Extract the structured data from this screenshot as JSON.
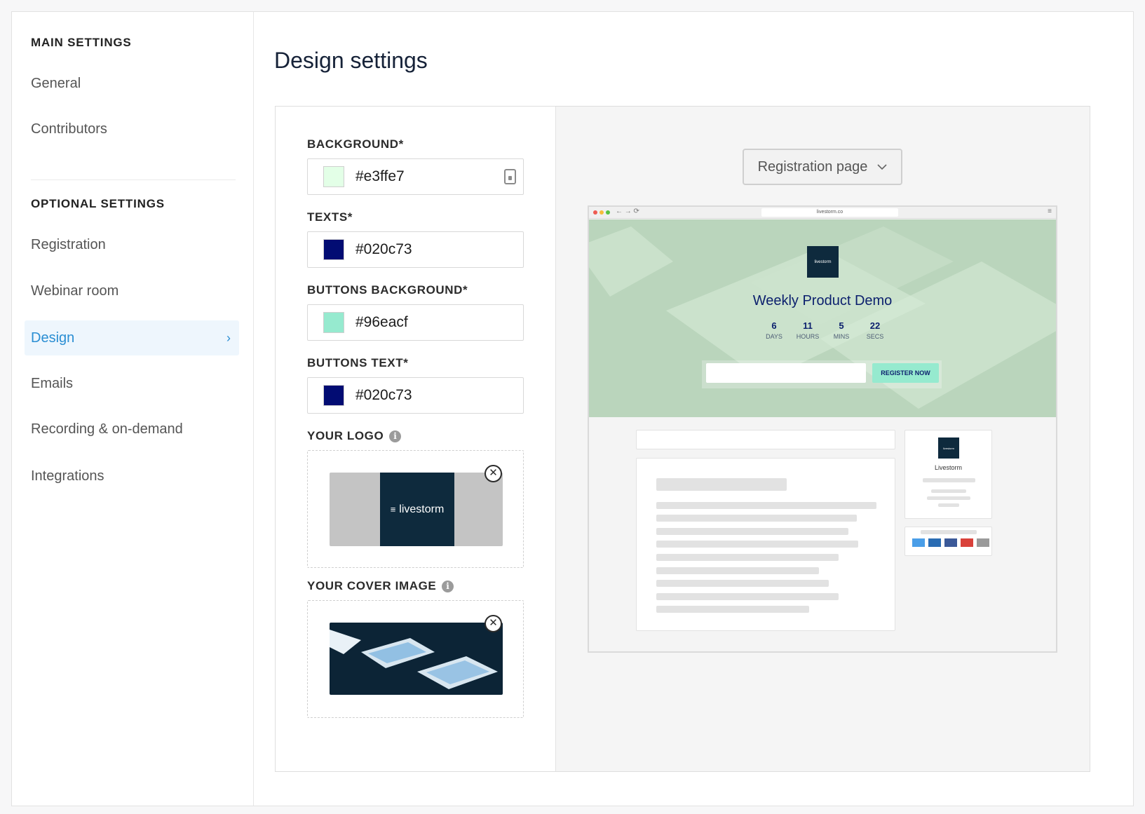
{
  "sidebar": {
    "main_heading": "MAIN SETTINGS",
    "main_items": [
      {
        "label": "General"
      },
      {
        "label": "Contributors"
      }
    ],
    "optional_heading": "OPTIONAL SETTINGS",
    "optional_items": [
      {
        "label": "Registration"
      },
      {
        "label": "Webinar room"
      },
      {
        "label": "Design",
        "active": true
      },
      {
        "label": "Emails"
      },
      {
        "label": "Recording & on-demand"
      },
      {
        "label": "Integrations"
      }
    ]
  },
  "page": {
    "title": "Design settings"
  },
  "form": {
    "background": {
      "label": "BACKGROUND*",
      "value": "#e3ffe7"
    },
    "texts": {
      "label": "TEXTS*",
      "value": "#020c73"
    },
    "buttons_background": {
      "label": "BUTTONS BACKGROUND*",
      "value": "#96eacf"
    },
    "buttons_text": {
      "label": "BUTTONS TEXT*",
      "value": "#020c73"
    },
    "logo": {
      "label": "YOUR LOGO",
      "text": "livestorm"
    },
    "cover": {
      "label": "YOUR COVER IMAGE"
    }
  },
  "preview": {
    "page_select": "Registration page",
    "url": "livestorm.co",
    "logo_text": "livestorm",
    "event_title": "Weekly Product Demo",
    "countdown": [
      {
        "value": "6",
        "unit": "DAYS"
      },
      {
        "value": "11",
        "unit": "HOURS"
      },
      {
        "value": "5",
        "unit": "MINS"
      },
      {
        "value": "22",
        "unit": "SECS"
      }
    ],
    "register_button": "REGISTER NOW",
    "organizer_name": "Livestorm",
    "organizer_logo_text": "livestorm"
  },
  "colors": {
    "accent": "#2a8ed3",
    "hero_bg": "#bad5bc",
    "text_color": "#020c73",
    "button_bg": "#96eacf",
    "logo_bg": "#0e2a3d"
  }
}
